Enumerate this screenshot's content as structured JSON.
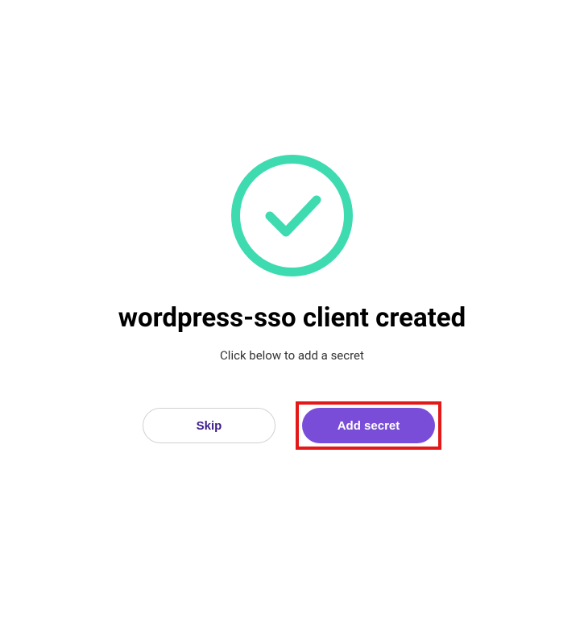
{
  "success": {
    "title": "wordpress-sso client created",
    "subtitle": "Click below to add a secret"
  },
  "buttons": {
    "skip_label": "Skip",
    "add_secret_label": "Add secret"
  },
  "colors": {
    "check": "#3edbb1",
    "primary": "#7a4dd9",
    "highlight": "#e31818"
  }
}
